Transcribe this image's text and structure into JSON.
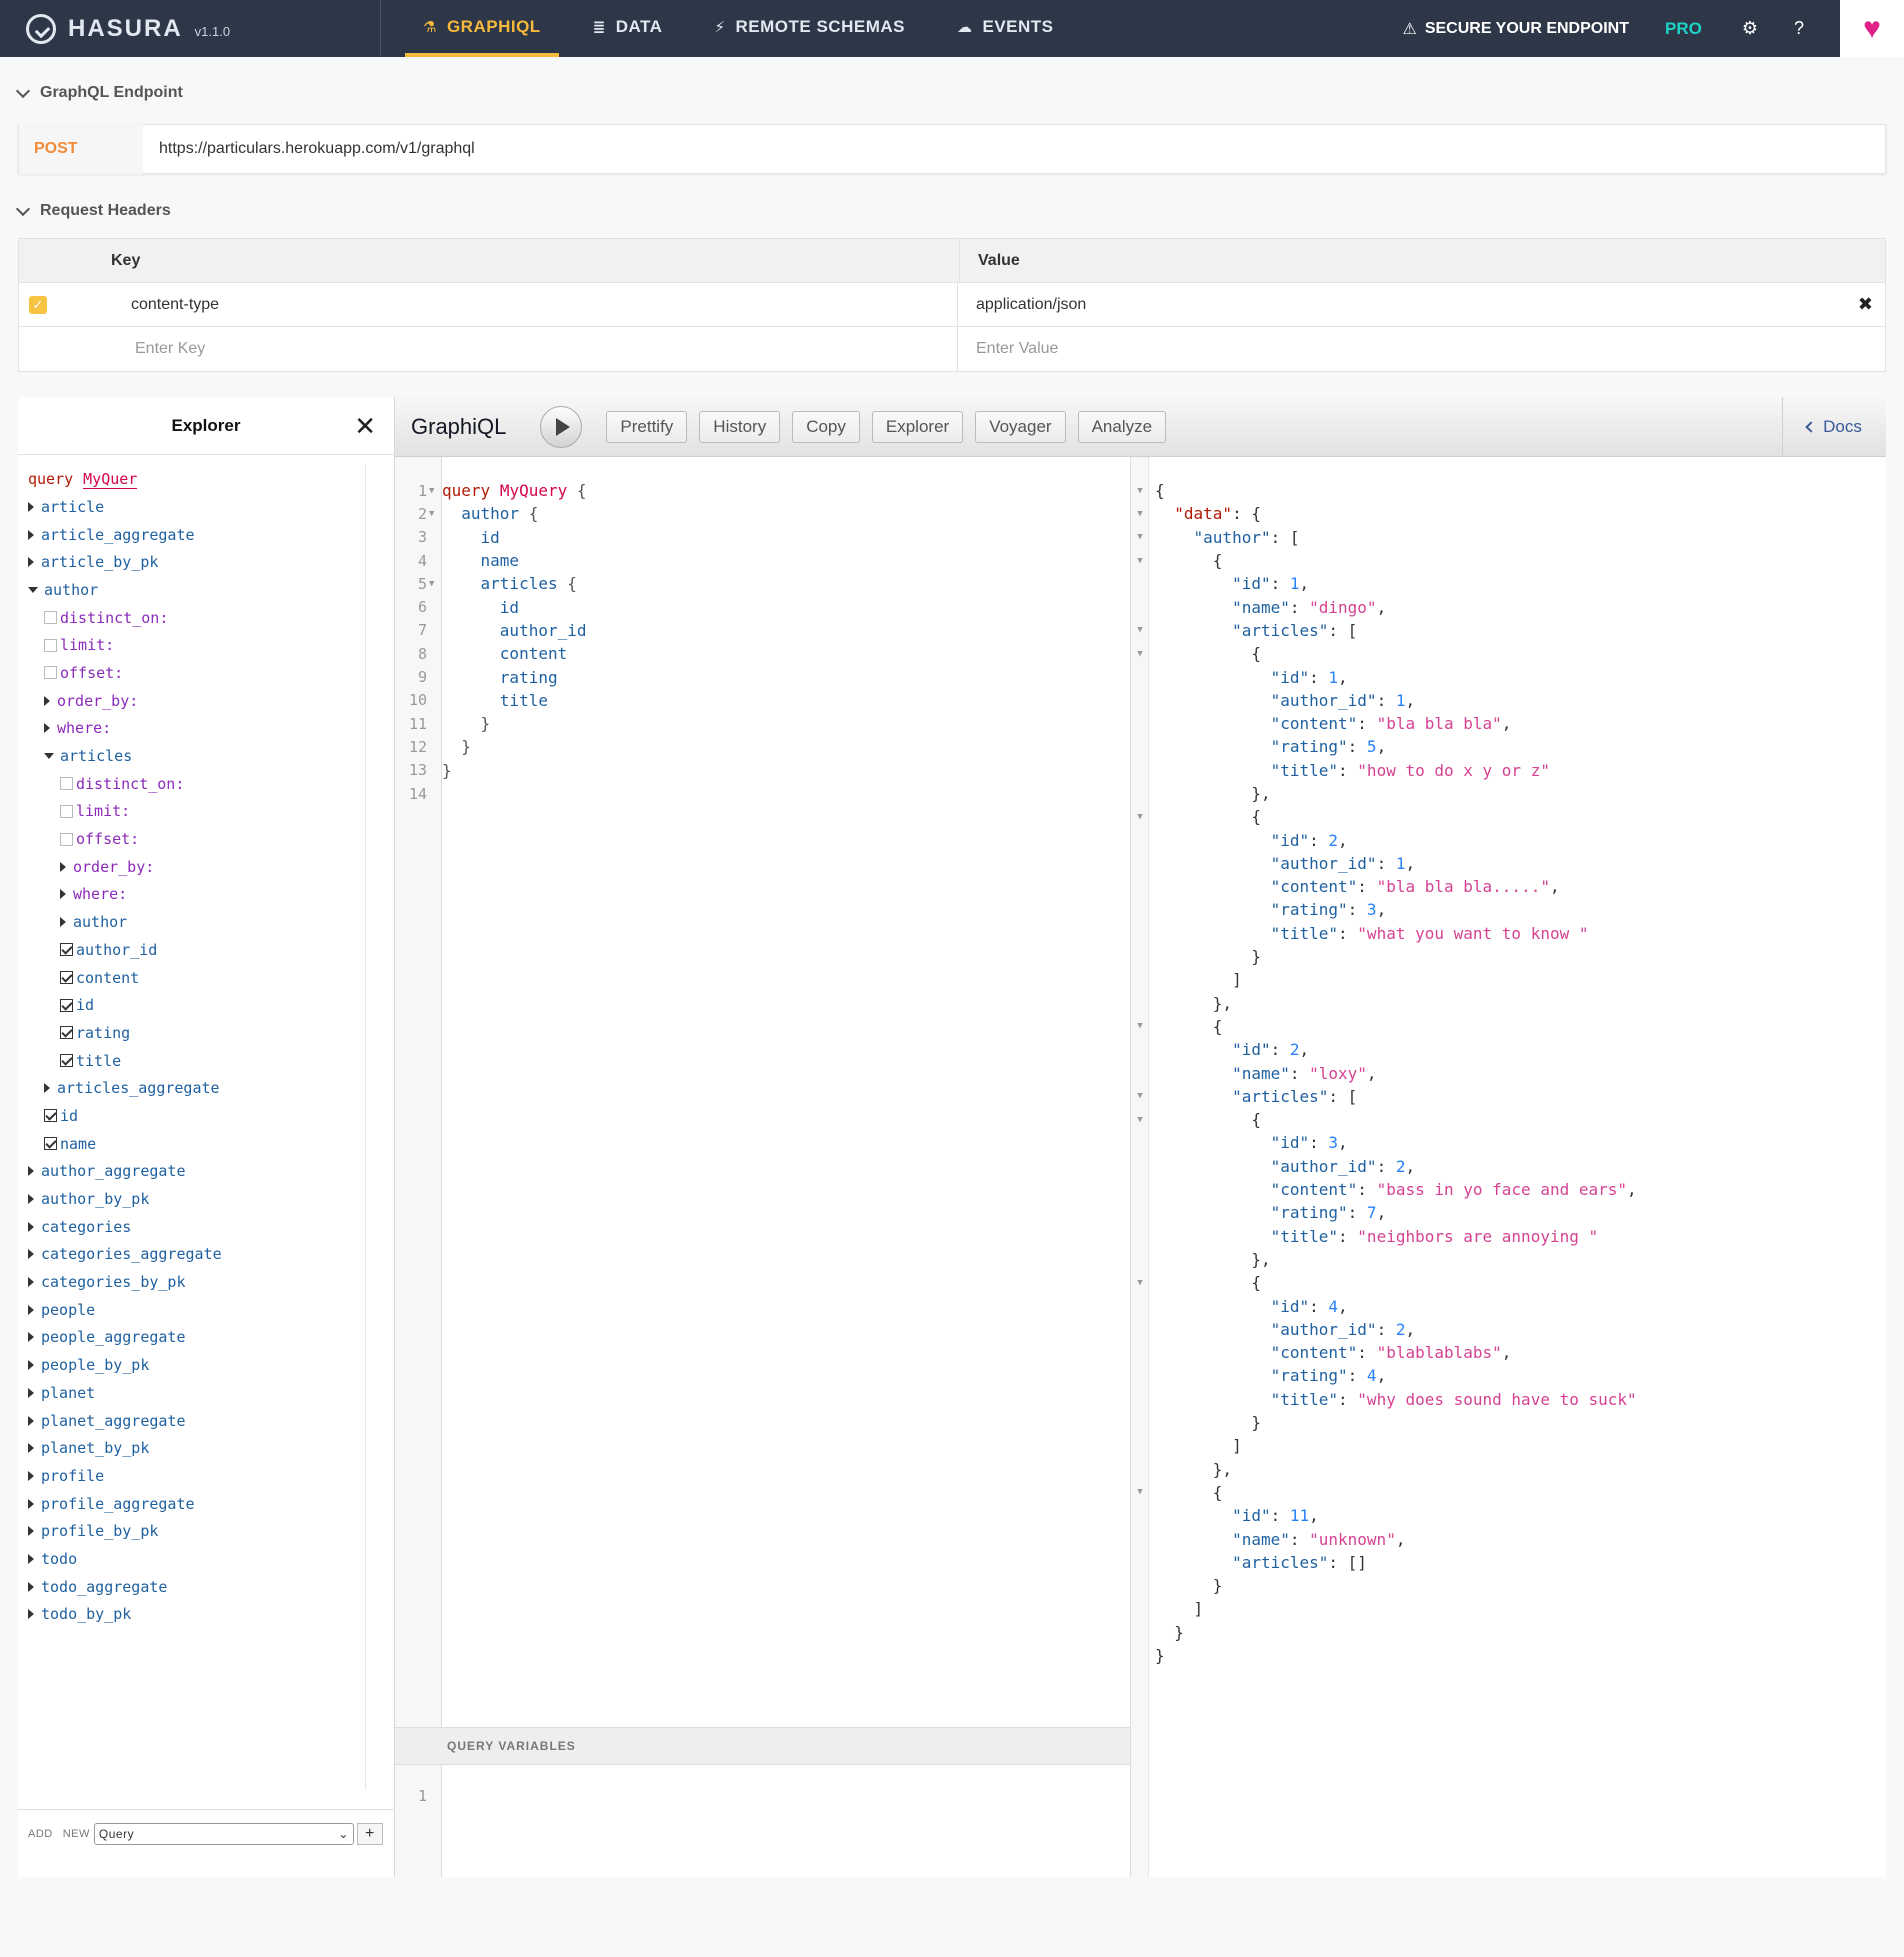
{
  "nav": {
    "brand": "HASURA",
    "version": "v1.1.0",
    "tabs": [
      {
        "label": "GRAPHIQL",
        "icon": "flask-icon",
        "glyph": "⚗",
        "active": true
      },
      {
        "label": "DATA",
        "icon": "database-icon",
        "glyph": "≣",
        "active": false
      },
      {
        "label": "REMOTE SCHEMAS",
        "icon": "plug-icon",
        "glyph": "⚡",
        "active": false
      },
      {
        "label": "EVENTS",
        "icon": "cloud-icon",
        "glyph": "☁",
        "active": false
      }
    ],
    "secure": "SECURE YOUR ENDPOINT",
    "pro": "PRO",
    "settings_glyph": "⚙",
    "help_glyph": "?",
    "heart_glyph": "♥"
  },
  "endpoint": {
    "section_title": "GraphQL Endpoint",
    "method": "POST",
    "url": "https://particulars.herokuapp.com/v1/graphql"
  },
  "headers": {
    "section_title": "Request Headers",
    "key_col": "Key",
    "value_col": "Value",
    "rows": [
      {
        "key": "content-type",
        "value": "application/json",
        "enabled": true
      }
    ],
    "key_placeholder": "Enter Key",
    "value_placeholder": "Enter Value"
  },
  "explorer": {
    "title": "Explorer",
    "op_keyword": "query",
    "op_name": "MyQuer",
    "footer_add": "ADD",
    "footer_new": "NEW",
    "footer_select": "Query",
    "footer_plus": "+"
  },
  "graphiql": {
    "title": "GraphiQL",
    "buttons": [
      "Prettify",
      "History",
      "Copy",
      "Explorer",
      "Voyager",
      "Analyze"
    ],
    "docs": "Docs",
    "query_variables": "QUERY VARIABLES",
    "vars_line": "1"
  },
  "query_lines": [
    "query MyQuery {",
    "  author {",
    "    id",
    "    name",
    "    articles {",
    "      id",
    "      author_id",
    "      content",
    "      rating",
    "      title",
    "    }",
    "  }",
    "}",
    ""
  ],
  "result_lines": [
    "{",
    "  \"data\": {",
    "    \"author\": [",
    "      {",
    "        \"id\": 1,",
    "        \"name\": \"dingo\",",
    "        \"articles\": [",
    "          {",
    "            \"id\": 1,",
    "            \"author_id\": 1,",
    "            \"content\": \"bla bla bla\",",
    "            \"rating\": 5,",
    "            \"title\": \"how to do x y or z\"",
    "          },",
    "          {",
    "            \"id\": 2,",
    "            \"author_id\": 1,",
    "            \"content\": \"bla bla bla.....\",",
    "            \"rating\": 3,",
    "            \"title\": \"what you want to know \"",
    "          }",
    "        ]",
    "      },",
    "      {",
    "        \"id\": 2,",
    "        \"name\": \"loxy\",",
    "        \"articles\": [",
    "          {",
    "            \"id\": 3,",
    "            \"author_id\": 2,",
    "            \"content\": \"bass in yo face and ears\",",
    "            \"rating\": 7,",
    "            \"title\": \"neighbors are annoying \"",
    "          },",
    "          {",
    "            \"id\": 4,",
    "            \"author_id\": 2,",
    "            \"content\": \"blablablabs\",",
    "            \"rating\": 4,",
    "            \"title\": \"why does sound have to suck\"",
    "          }",
    "        ]",
    "      },",
    "      {",
    "        \"id\": 11,",
    "        \"name\": \"unknown\",",
    "        \"articles\": []",
    "      }",
    "    ]",
    "  }",
    "}"
  ],
  "tree": [
    {
      "label": "article",
      "kind": "field",
      "depth": 0,
      "ctrl": "tri"
    },
    {
      "label": "article_aggregate",
      "kind": "field",
      "depth": 0,
      "ctrl": "tri"
    },
    {
      "label": "article_by_pk",
      "kind": "field",
      "depth": 0,
      "ctrl": "tri"
    },
    {
      "label": "author",
      "kind": "field",
      "depth": 0,
      "ctrl": "tri-down"
    },
    {
      "label": "distinct_on:",
      "kind": "arg",
      "depth": 1,
      "ctrl": "cb"
    },
    {
      "label": "limit:",
      "kind": "arg",
      "depth": 1,
      "ctrl": "cb"
    },
    {
      "label": "offset:",
      "kind": "arg",
      "depth": 1,
      "ctrl": "cb"
    },
    {
      "label": "order_by:",
      "kind": "arg",
      "depth": 1,
      "ctrl": "tri"
    },
    {
      "label": "where:",
      "kind": "arg",
      "depth": 1,
      "ctrl": "tri"
    },
    {
      "label": "articles",
      "kind": "field",
      "depth": 1,
      "ctrl": "tri-down"
    },
    {
      "label": "distinct_on:",
      "kind": "arg",
      "depth": 2,
      "ctrl": "cb"
    },
    {
      "label": "limit:",
      "kind": "arg",
      "depth": 2,
      "ctrl": "cb"
    },
    {
      "label": "offset:",
      "kind": "arg",
      "depth": 2,
      "ctrl": "cb"
    },
    {
      "label": "order_by:",
      "kind": "arg",
      "depth": 2,
      "ctrl": "tri"
    },
    {
      "label": "where:",
      "kind": "arg",
      "depth": 2,
      "ctrl": "tri"
    },
    {
      "label": "author",
      "kind": "field",
      "depth": 2,
      "ctrl": "tri"
    },
    {
      "label": "author_id",
      "kind": "field",
      "depth": 2,
      "ctrl": "cb-on"
    },
    {
      "label": "content",
      "kind": "field",
      "depth": 2,
      "ctrl": "cb-on"
    },
    {
      "label": "id",
      "kind": "field",
      "depth": 2,
      "ctrl": "cb-on"
    },
    {
      "label": "rating",
      "kind": "field",
      "depth": 2,
      "ctrl": "cb-on"
    },
    {
      "label": "title",
      "kind": "field",
      "depth": 2,
      "ctrl": "cb-on"
    },
    {
      "label": "articles_aggregate",
      "kind": "field",
      "depth": 1,
      "ctrl": "tri"
    },
    {
      "label": "id",
      "kind": "field",
      "depth": 1,
      "ctrl": "cb-on"
    },
    {
      "label": "name",
      "kind": "field",
      "depth": 1,
      "ctrl": "cb-on"
    },
    {
      "label": "author_aggregate",
      "kind": "field",
      "depth": 0,
      "ctrl": "tri"
    },
    {
      "label": "author_by_pk",
      "kind": "field",
      "depth": 0,
      "ctrl": "tri"
    },
    {
      "label": "categories",
      "kind": "field",
      "depth": 0,
      "ctrl": "tri"
    },
    {
      "label": "categories_aggregate",
      "kind": "field",
      "depth": 0,
      "ctrl": "tri"
    },
    {
      "label": "categories_by_pk",
      "kind": "field",
      "depth": 0,
      "ctrl": "tri"
    },
    {
      "label": "people",
      "kind": "field",
      "depth": 0,
      "ctrl": "tri"
    },
    {
      "label": "people_aggregate",
      "kind": "field",
      "depth": 0,
      "ctrl": "tri"
    },
    {
      "label": "people_by_pk",
      "kind": "field",
      "depth": 0,
      "ctrl": "tri"
    },
    {
      "label": "planet",
      "kind": "field",
      "depth": 0,
      "ctrl": "tri"
    },
    {
      "label": "planet_aggregate",
      "kind": "field",
      "depth": 0,
      "ctrl": "tri"
    },
    {
      "label": "planet_by_pk",
      "kind": "field",
      "depth": 0,
      "ctrl": "tri"
    },
    {
      "label": "profile",
      "kind": "field",
      "depth": 0,
      "ctrl": "tri"
    },
    {
      "label": "profile_aggregate",
      "kind": "field",
      "depth": 0,
      "ctrl": "tri"
    },
    {
      "label": "profile_by_pk",
      "kind": "field",
      "depth": 0,
      "ctrl": "tri"
    },
    {
      "label": "todo",
      "kind": "field",
      "depth": 0,
      "ctrl": "tri"
    },
    {
      "label": "todo_aggregate",
      "kind": "field",
      "depth": 0,
      "ctrl": "tri"
    },
    {
      "label": "todo_by_pk",
      "kind": "field",
      "depth": 0,
      "ctrl": "tri"
    }
  ],
  "colors": {
    "nav_bg": "#2d3748",
    "active_tab": "#f6b93b",
    "pro": "#1cd3c6",
    "method": "#f28c38"
  }
}
